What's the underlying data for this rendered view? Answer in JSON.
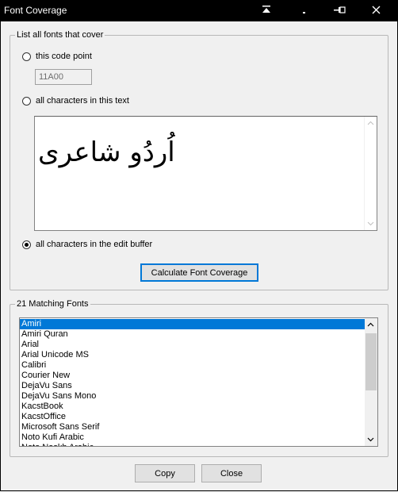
{
  "window": {
    "title": "Font Coverage",
    "controls": [
      "minimize-to-top-icon",
      "minimize-icon",
      "pin-icon",
      "close-icon"
    ]
  },
  "cover_group": {
    "legend": "List all fonts that cover",
    "opt_code_point": "this code point",
    "code_point_value": "11A00",
    "opt_text": "all characters in this text",
    "sample_text": "اُردُو شاعری",
    "opt_edit_buffer": "all characters in the edit buffer",
    "selected_option": "all characters in the edit buffer",
    "calc_button": "Calculate Font Coverage"
  },
  "results_group": {
    "legend": "21 Matching Fonts",
    "selected_font": "Amiri",
    "fonts": [
      "Amiri",
      "Amiri Quran",
      "Arial",
      "Arial Unicode MS",
      "Calibri",
      "Courier New",
      "DejaVu Sans",
      "DejaVu Sans Mono",
      "KacstBook",
      "KacstOffice",
      "Microsoft Sans Serif",
      "Noto Kufi Arabic",
      "Noto Naskh Arabic"
    ]
  },
  "footer": {
    "copy_label": "Copy",
    "close_label": "Close"
  }
}
